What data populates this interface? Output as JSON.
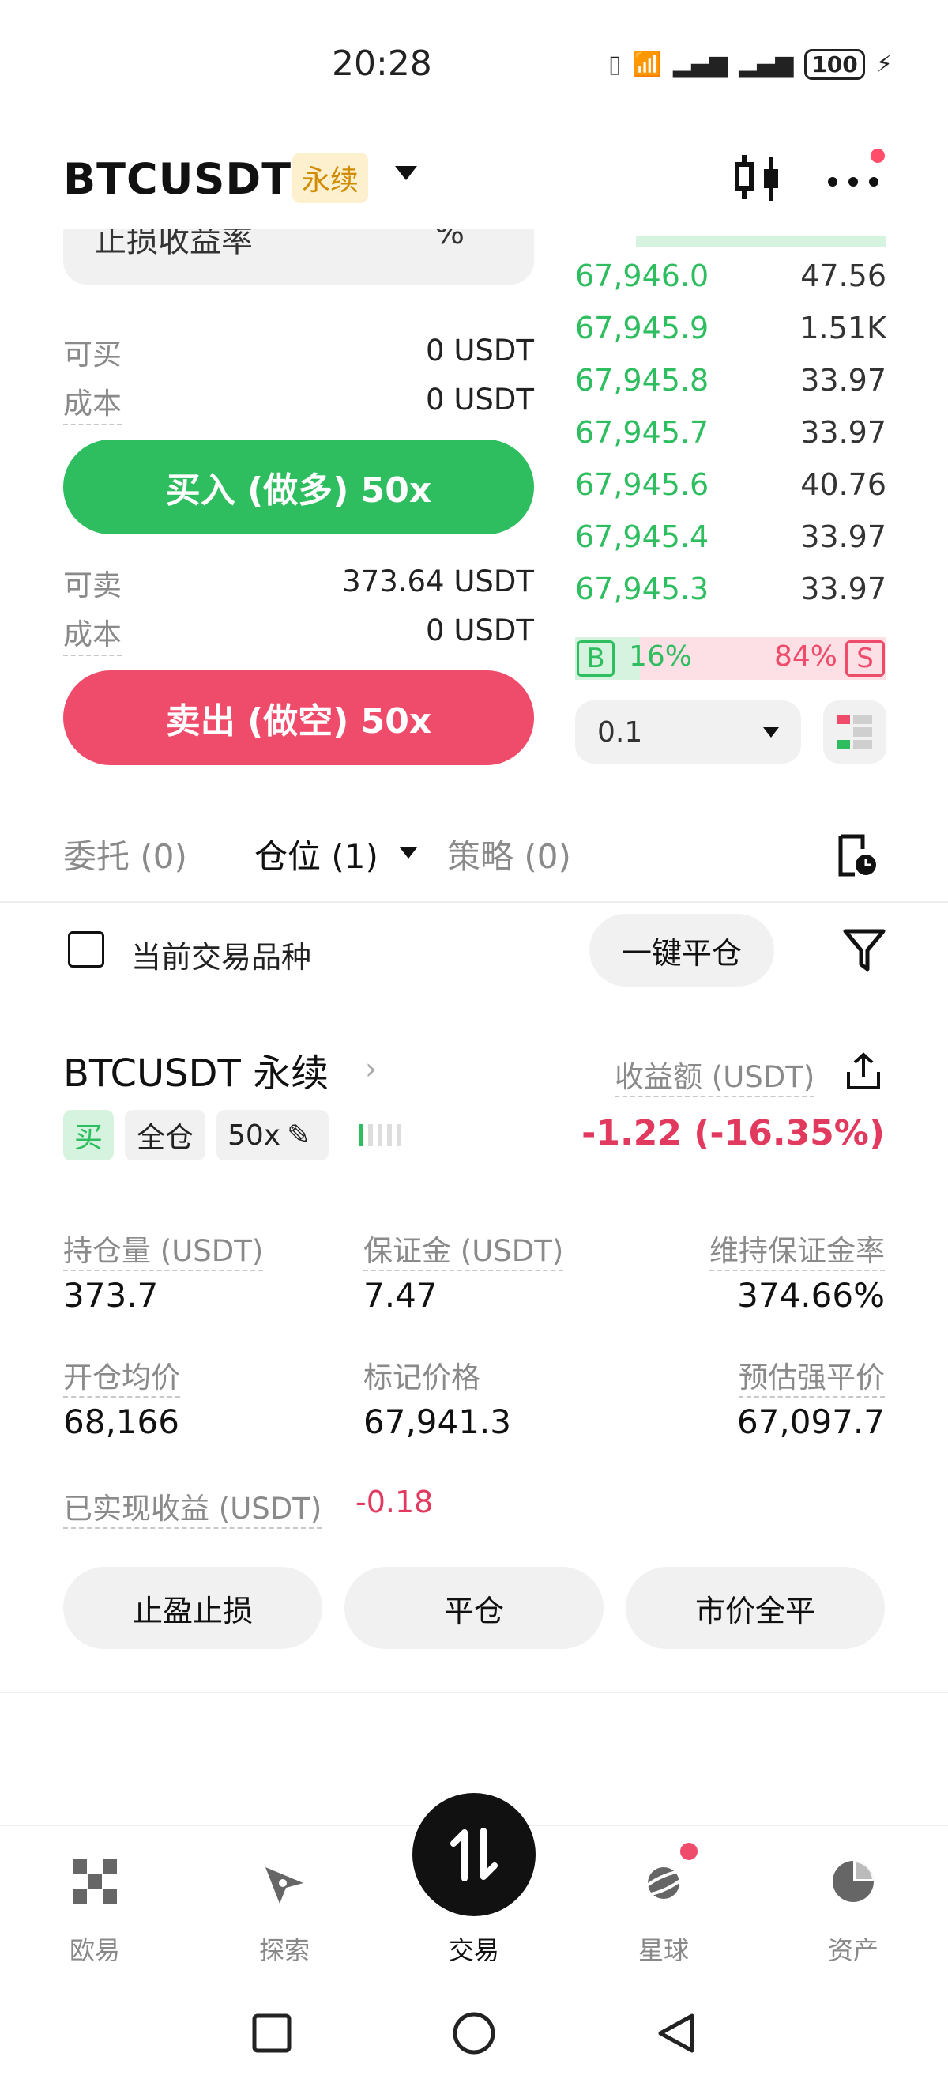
{
  "status_bar": {
    "time": "20:28",
    "battery": "100"
  },
  "header": {
    "symbol": "BTCUSDT",
    "badge": "永续"
  },
  "trade_panel": {
    "partial_label": "止损收益率",
    "partial_unit": "%",
    "buy_available_label": "可买",
    "buy_available_value": "0 USDT",
    "buy_cost_label": "成本",
    "buy_cost_value": "0 USDT",
    "buy_button": "买入 (做多) 50x",
    "sell_available_label": "可卖",
    "sell_available_value": "373.64 USDT",
    "sell_cost_label": "成本",
    "sell_cost_value": "0 USDT",
    "sell_button": "卖出 (做空) 50x"
  },
  "order_book": {
    "rows": [
      {
        "price": "67,946.0",
        "qty": "47.56"
      },
      {
        "price": "67,945.9",
        "qty": "1.51K"
      },
      {
        "price": "67,945.8",
        "qty": "33.97"
      },
      {
        "price": "67,945.7",
        "qty": "33.97"
      },
      {
        "price": "67,945.6",
        "qty": "40.76"
      },
      {
        "price": "67,945.4",
        "qty": "33.97"
      },
      {
        "price": "67,945.3",
        "qty": "33.97"
      }
    ],
    "buy_letter": "B",
    "buy_pct": "16%",
    "sell_letter": "S",
    "sell_pct": "84%",
    "depth_value": "0.1"
  },
  "tabs": {
    "orders": "委托 (0)",
    "positions": "仓位 (1)",
    "strategies": "策略 (0)"
  },
  "filter_bar": {
    "checkbox_label": "当前交易品种",
    "close_all": "一键平仓"
  },
  "position": {
    "title": "BTCUSDT 永续",
    "pnl_label": "收益额 (USDT)",
    "tag_side": "买",
    "tag_margin": "全仓",
    "tag_leverage": "50x",
    "pnl_value": "-1.22 (-16.35%)",
    "size_label": "持仓量 (USDT)",
    "size_value": "373.7",
    "margin_label": "保证金 (USDT)",
    "margin_value": "7.47",
    "mmr_label": "维持保证金率",
    "mmr_value": "374.66%",
    "entry_label": "开仓均价",
    "entry_value": "68,166",
    "mark_label": "标记价格",
    "mark_value": "67,941.3",
    "liq_label": "预估强平价",
    "liq_value": "67,097.7",
    "realized_label": "已实现收益 (USDT)",
    "realized_value": "-0.18",
    "btn_tpsl": "止盈止损",
    "btn_close": "平仓",
    "btn_market_close": "市价全平"
  },
  "bottom_nav": {
    "items": [
      {
        "label": "欧易",
        "icon": "okx-logo-icon"
      },
      {
        "label": "探索",
        "icon": "compass-icon"
      },
      {
        "label": "交易",
        "icon": "swap-arrows-icon"
      },
      {
        "label": "星球",
        "icon": "planet-icon"
      },
      {
        "label": "资产",
        "icon": "pie-chart-icon"
      }
    ]
  },
  "colors": {
    "green": "#2ebd5f",
    "red": "#ef4b6b",
    "badge_bg": "#fdf0cf",
    "badge_text": "#d18b00"
  }
}
